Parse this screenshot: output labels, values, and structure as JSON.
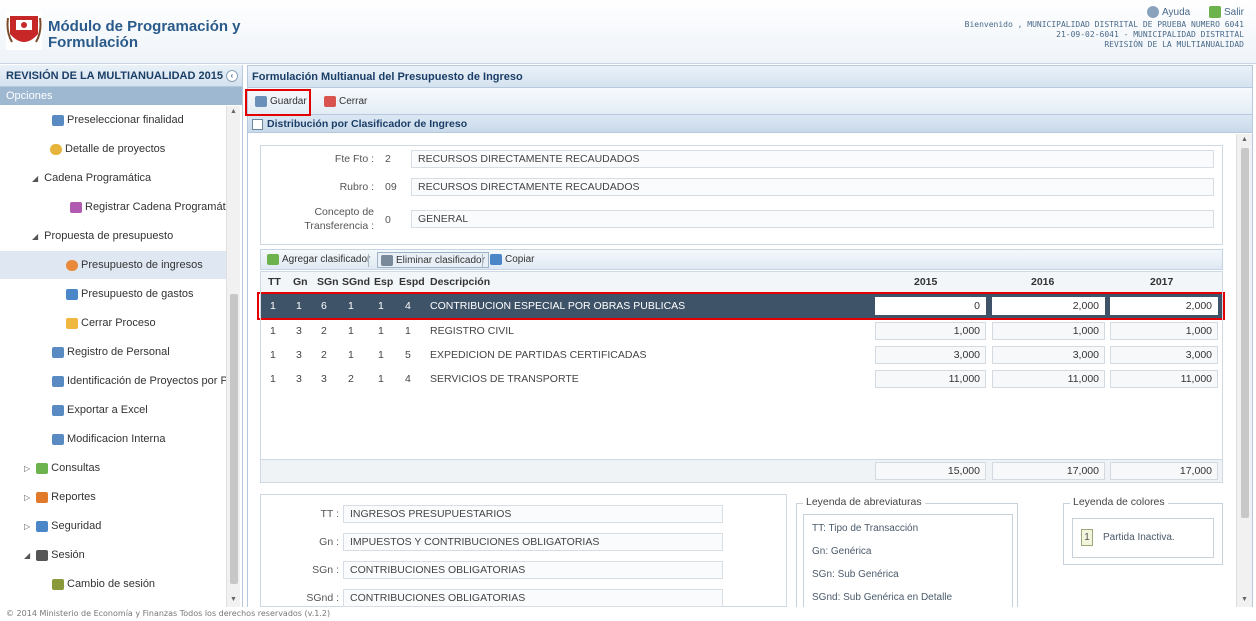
{
  "header": {
    "app_title": "Módulo de Programación y Formulación",
    "help_label": "Ayuda",
    "exit_label": "Salir",
    "welcome_line": "Bienvenido , MUNICIPALIDAD DISTRITAL DE PRUEBA NUMERO 6041",
    "user_line": "21-09-02-6041 - MUNICIPALIDAD DISTRITAL",
    "context_line": "REVISIÓN DE LA MULTIANUALIDAD"
  },
  "sidebar": {
    "title": "REVISIÓN DE LA MULTIANUALIDAD 2015",
    "collapse_icon": "‹",
    "section_label": "Opciones",
    "items": [
      {
        "label": "Preseleccionar finalidad",
        "icon": "tree-icon"
      },
      {
        "label": "Detalle de proyectos",
        "icon": "folder-icon"
      },
      {
        "label": "Cadena Programática",
        "icon": "expanded-triangle"
      },
      {
        "label": "Registrar Cadena Programática",
        "icon": "chain-icon"
      },
      {
        "label": "Propuesta de presupuesto",
        "icon": "expanded-triangle"
      },
      {
        "label": "Presupuesto de ingresos",
        "icon": "income-icon"
      },
      {
        "label": "Presupuesto de gastos",
        "icon": "expense-icon"
      },
      {
        "label": "Cerrar Proceso",
        "icon": "close-process-icon"
      },
      {
        "label": "Registro de Personal",
        "icon": "form-icon"
      },
      {
        "label": "Identificación de Proyectos por Proc",
        "icon": "form-icon"
      },
      {
        "label": "Exportar a Excel",
        "icon": "form-icon"
      },
      {
        "label": "Modificacion Interna",
        "icon": "form-icon"
      },
      {
        "label": "Consultas",
        "icon": "folder-icon"
      },
      {
        "label": "Reportes",
        "icon": "reports-icon"
      },
      {
        "label": "Seguridad",
        "icon": "security-icon"
      },
      {
        "label": "Sesión",
        "icon": "session-icon"
      },
      {
        "label": "Cambio de sesión",
        "icon": "change-session-icon"
      }
    ]
  },
  "main": {
    "title": "Formulación Multianual del Presupuesto de Ingreso",
    "toolbar": {
      "save_label": "Guardar",
      "close_label": "Cerrar"
    },
    "section_title": "Distribución por Clasificador de Ingreso",
    "form": {
      "fte_label": "Fte Fto :",
      "fte_code": "2",
      "fte_value": "RECURSOS DIRECTAMENTE RECAUDADOS",
      "rubro_label": "Rubro :",
      "rubro_code": "09",
      "rubro_value": "RECURSOS DIRECTAMENTE RECAUDADOS",
      "concepto_label_1": "Concepto de",
      "concepto_label_2": "Transferencia :",
      "concepto_code": "0",
      "concepto_value": "GENERAL"
    },
    "grid_toolbar": {
      "add_label": "Agregar clasificador",
      "delete_label": "Eliminar clasificador",
      "copy_label": "Copiar"
    },
    "columns": [
      "TT",
      "Gn",
      "SGn",
      "SGnd",
      "Esp",
      "Espd",
      "Descripción",
      "2015",
      "2016",
      "2017"
    ],
    "rows": [
      {
        "tt": "1",
        "gn": "1",
        "sgn": "6",
        "sgnd": "1",
        "esp": "1",
        "espd": "4",
        "desc": "CONTRIBUCION ESPECIAL POR OBRAS PUBLICAS",
        "y2015": "0",
        "y2016": "2,000",
        "y2017": "2,000"
      },
      {
        "tt": "1",
        "gn": "3",
        "sgn": "2",
        "sgnd": "1",
        "esp": "1",
        "espd": "1",
        "desc": "REGISTRO CIVIL",
        "y2015": "1,000",
        "y2016": "1,000",
        "y2017": "1,000"
      },
      {
        "tt": "1",
        "gn": "3",
        "sgn": "2",
        "sgnd": "1",
        "esp": "1",
        "espd": "5",
        "desc": "EXPEDICION DE PARTIDAS CERTIFICADAS",
        "y2015": "3,000",
        "y2016": "3,000",
        "y2017": "3,000"
      },
      {
        "tt": "1",
        "gn": "3",
        "sgn": "3",
        "sgnd": "2",
        "esp": "1",
        "espd": "4",
        "desc": "SERVICIOS DE TRANSPORTE",
        "y2015": "11,000",
        "y2016": "11,000",
        "y2017": "11,000"
      }
    ],
    "totals": {
      "y2015": "15,000",
      "y2016": "17,000",
      "y2017": "17,000"
    },
    "details": [
      {
        "label": "TT :",
        "value": "INGRESOS PRESUPUESTARIOS"
      },
      {
        "label": "Gn :",
        "value": "IMPUESTOS Y CONTRIBUCIONES OBLIGATORIAS"
      },
      {
        "label": "SGn :",
        "value": "CONTRIBUCIONES OBLIGATORIAS"
      },
      {
        "label": "SGnd :",
        "value": "CONTRIBUCIONES OBLIGATORIAS"
      }
    ],
    "abbrev_legend": {
      "title": "Leyenda de abreviaturas",
      "items": [
        "TT: Tipo de Transacción",
        "Gn: Genérica",
        "SGn: Sub Genérica",
        "SGnd: Sub Genérica en Detalle"
      ]
    },
    "color_legend": {
      "title": "Leyenda de colores",
      "swatch": "1",
      "label": "Partida Inactiva."
    }
  },
  "footer": "© 2014 Ministerio de Economía y Finanzas Todos los derechos reservados (v.1.2)",
  "colors": {
    "selected_row": "#3e5368",
    "highlight": "#e30000",
    "header_blue": "#2a5a8a"
  }
}
